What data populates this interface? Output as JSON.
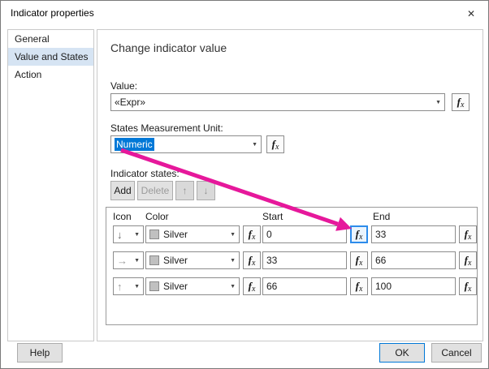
{
  "dialog": {
    "title": "Indicator properties"
  },
  "icons": {
    "close": "✕",
    "dropdown": "▼",
    "up": "↑",
    "down": "↓"
  },
  "sidebar": {
    "items": [
      {
        "label": "General"
      },
      {
        "label": "Value and States"
      },
      {
        "label": "Action"
      }
    ]
  },
  "main": {
    "heading": "Change indicator value",
    "value": {
      "label": "Value:",
      "text": "«Expr»"
    },
    "unit": {
      "label": "States Measurement Unit:",
      "value": "Numeric"
    },
    "states": {
      "label": "Indicator states:",
      "add": "Add",
      "delete": "Delete",
      "headers": {
        "icon": "Icon",
        "color": "Color",
        "start": "Start",
        "end": "End"
      },
      "rows": [
        {
          "icon": "↓",
          "color": "Silver",
          "start": "0",
          "end": "33"
        },
        {
          "icon": "→",
          "color": "Silver",
          "start": "33",
          "end": "66"
        },
        {
          "icon": "↑",
          "color": "Silver",
          "start": "66",
          "end": "100"
        }
      ]
    }
  },
  "fx": {
    "f": "f",
    "x": "x"
  },
  "footer": {
    "help": "Help",
    "ok": "OK",
    "cancel": "Cancel"
  },
  "colors": {
    "accent": "#0078d7",
    "annotation_arrow": "#e6189b",
    "silver": "#c0c0c0"
  }
}
